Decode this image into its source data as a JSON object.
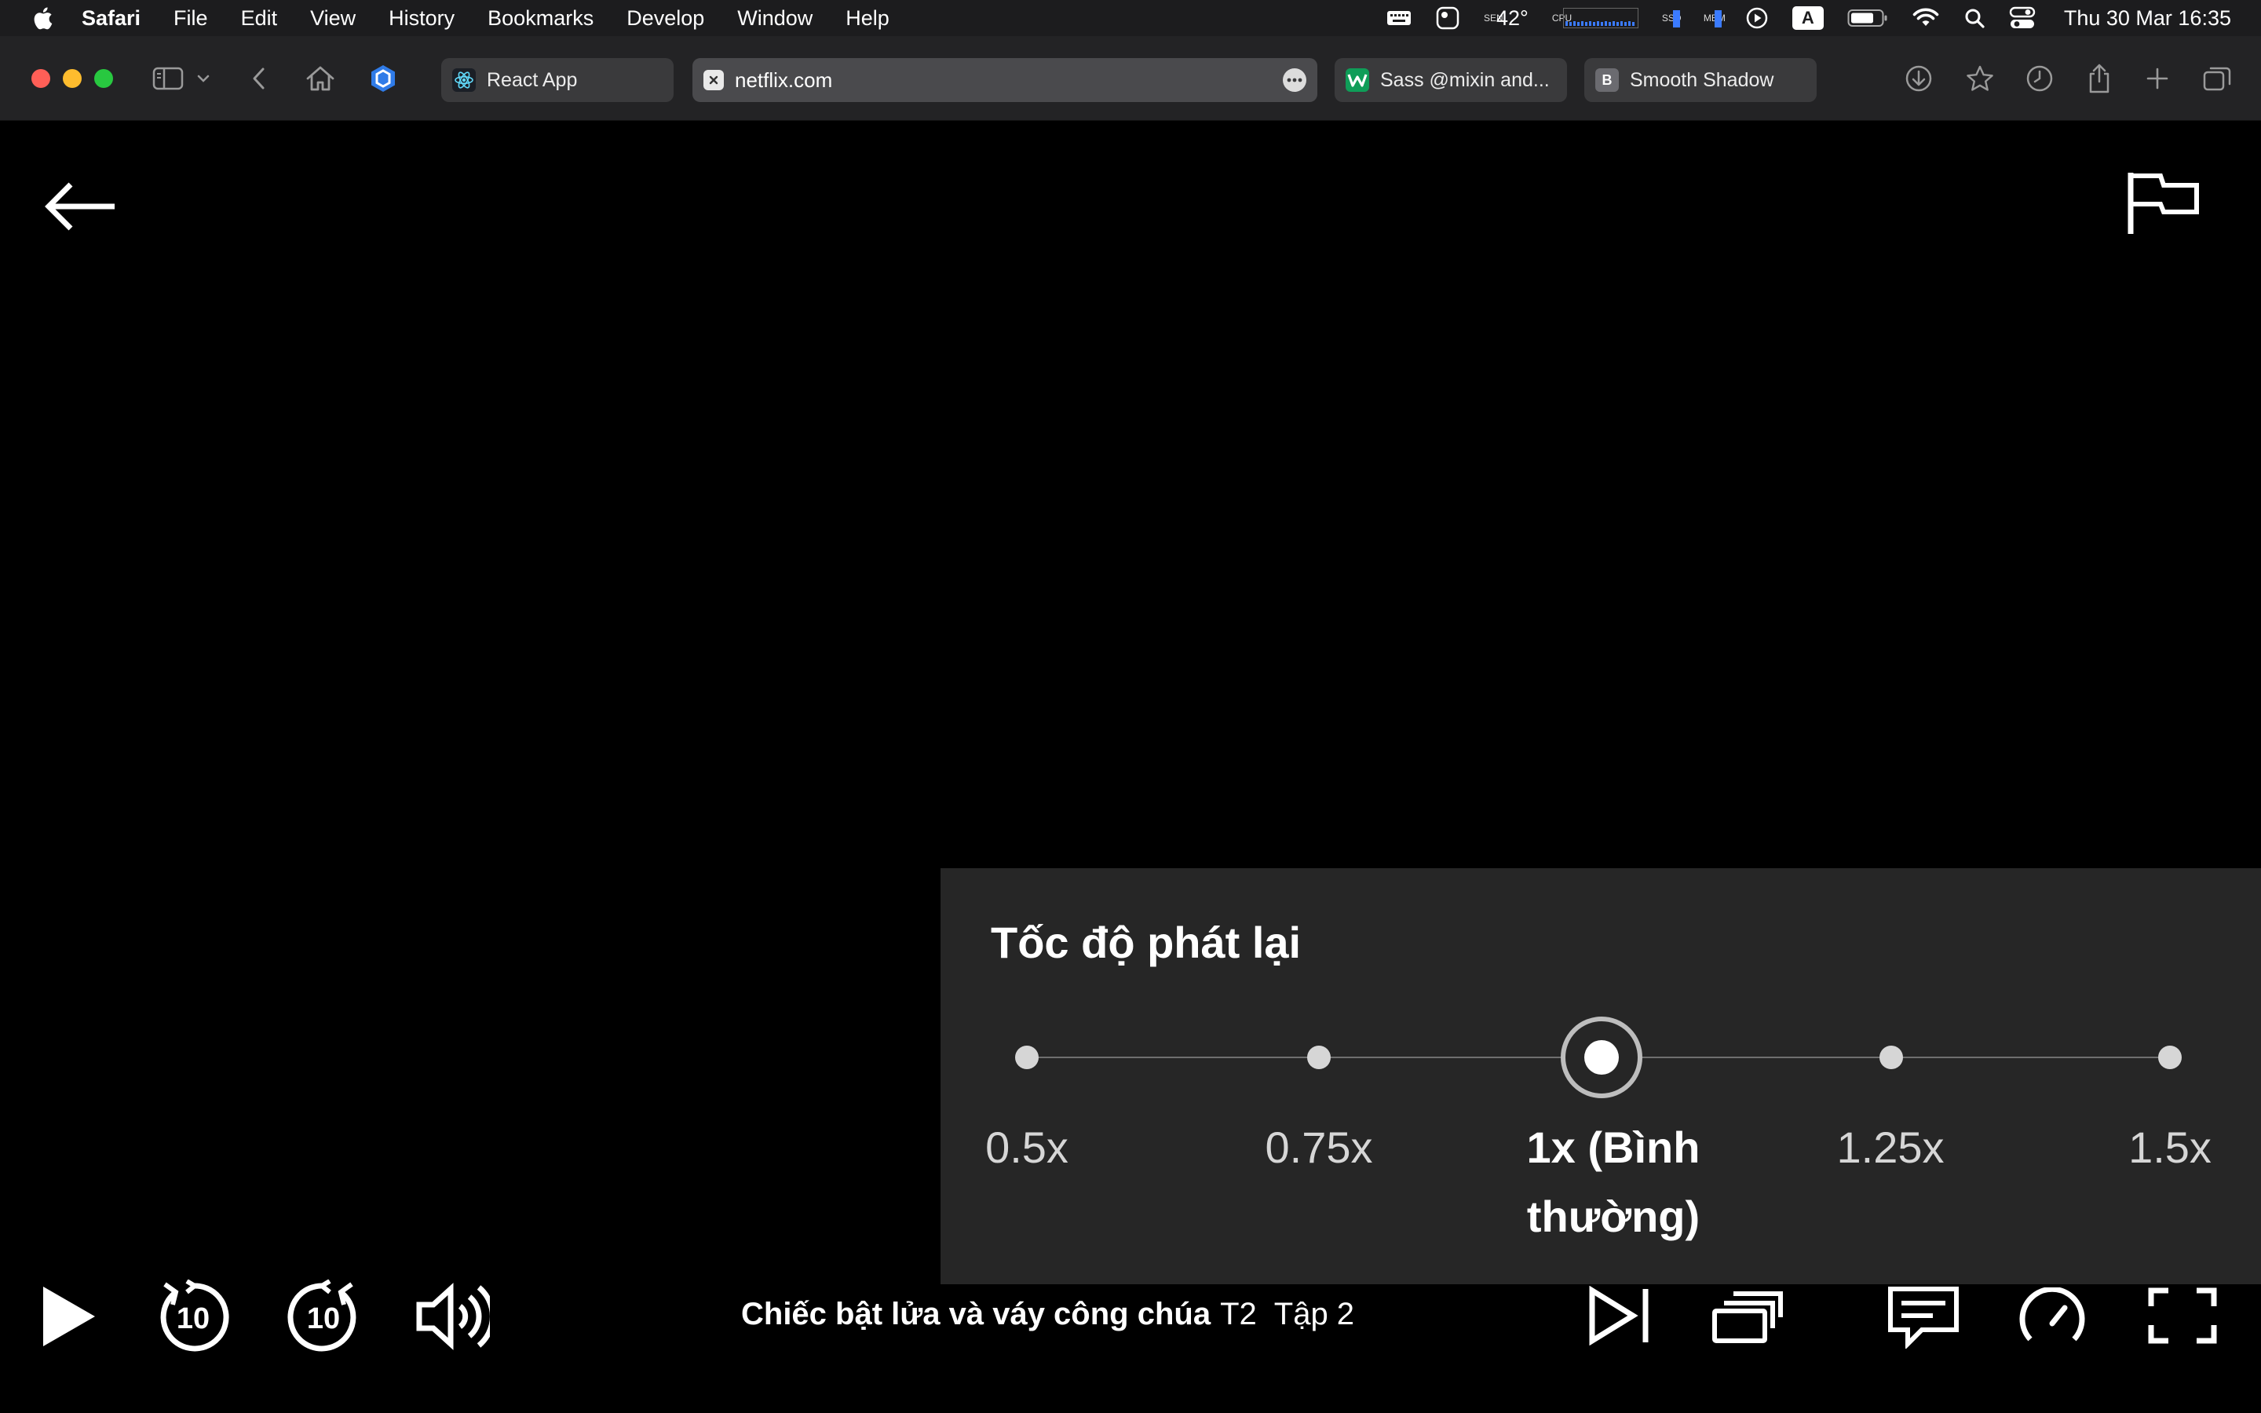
{
  "menubar": {
    "app_name": "Safari",
    "menus": [
      "File",
      "Edit",
      "View",
      "History",
      "Bookmarks",
      "Develop",
      "Window",
      "Help"
    ],
    "temperature": "42°",
    "sensor_label": "SEN",
    "cpu_label": "CPU",
    "ssd_label": "SSD",
    "mem_label": "MEM",
    "input_source": "A",
    "clock": "Thu 30 Mar  16:35"
  },
  "browser": {
    "tabs": [
      {
        "label": "React App",
        "icon": "react-icon"
      },
      {
        "label": "netflix.com",
        "icon": "close-icon",
        "active": true
      },
      {
        "label": "Sass @mixin and...",
        "icon": "w-favicon-icon"
      },
      {
        "label": "Smooth Shadow",
        "icon": "b-favicon-icon",
        "favicon_letter": "B"
      }
    ]
  },
  "player": {
    "speed_panel": {
      "title": "Tốc độ phát lại",
      "options": [
        "0.5x",
        "0.75x",
        "1x (Bình thường)",
        "1.25x",
        "1.5x"
      ],
      "selected_index": 2
    },
    "title": {
      "show": "Chiếc bật lửa và váy công chúa",
      "season": "T2",
      "episode": "Tập 2"
    },
    "rewind_seconds": "10",
    "forward_seconds": "10"
  },
  "colors": {
    "panel_bg": "#262626",
    "accent_blue": "#0a84ff",
    "close": "#ff5f57",
    "minimize": "#febc2e",
    "zoom": "#28c840"
  }
}
